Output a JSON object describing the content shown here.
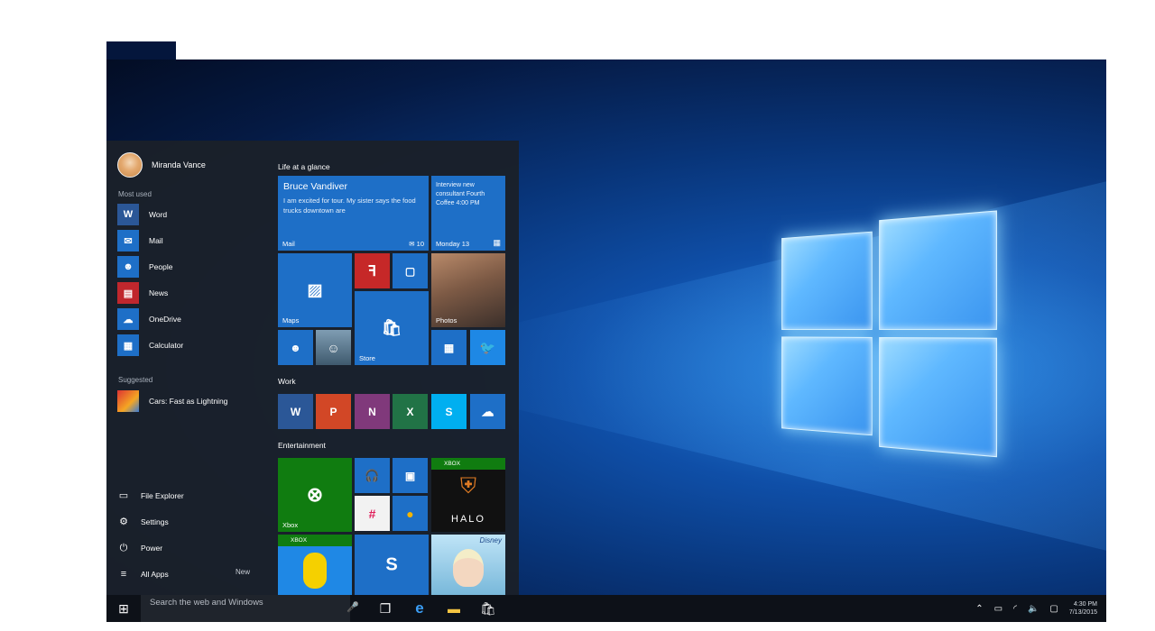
{
  "user": {
    "name": "Miranda Vance"
  },
  "sections": {
    "most_used": "Most used",
    "suggested": "Suggested"
  },
  "most_used": [
    {
      "label": "Word",
      "icon": "word-icon",
      "glyph": "W",
      "color": "#2b5797"
    },
    {
      "label": "Mail",
      "icon": "mail-icon",
      "glyph": "✉",
      "color": "#1e6fc7"
    },
    {
      "label": "People",
      "icon": "people-icon",
      "glyph": "👥",
      "color": "#1e6fc7"
    },
    {
      "label": "News",
      "icon": "news-icon",
      "glyph": "▤",
      "color": "#c0272d"
    },
    {
      "label": "OneDrive",
      "icon": "onedrive-icon",
      "glyph": "☁",
      "color": "#1e6fc7"
    },
    {
      "label": "Calculator",
      "icon": "calculator-icon",
      "glyph": "▦",
      "color": "#1e6fc7"
    }
  ],
  "suggested": [
    {
      "label": "Cars: Fast as Lightning",
      "icon": "cars-game-icon"
    }
  ],
  "system_items": [
    {
      "label": "File Explorer",
      "icon": "folder-icon",
      "glyph": "▭"
    },
    {
      "label": "Settings",
      "icon": "gear-icon",
      "glyph": "⚙"
    },
    {
      "label": "Power",
      "icon": "power-icon",
      "glyph": "⏻"
    },
    {
      "label": "All Apps",
      "icon": "all-apps-icon",
      "glyph": "≡"
    }
  ],
  "all_apps_badge": "New",
  "groups": {
    "life": "Life at a glance",
    "work": "Work",
    "entertainment": "Entertainment"
  },
  "tiles": {
    "mail": {
      "from": "Bruce Vandiver",
      "text": "I am excited for tour. My sister says the food trucks downtown are",
      "label": "Mail",
      "count": "10"
    },
    "calendar": {
      "text": "Interview new consultant Fourth Coffee 4:00 PM",
      "label": "Monday 13"
    },
    "maps": {
      "label": "Maps"
    },
    "photos": {
      "label": "Photos"
    },
    "store": {
      "label": "Store"
    },
    "xbox": {
      "label": "Xbox"
    },
    "xbox_badge": "XBOX",
    "halo": "HALO",
    "disney": "Disney"
  },
  "colors": {
    "tile_blue": "#1e6fc7",
    "flipboard_red": "#c62828",
    "word": "#2b5797",
    "powerpoint": "#d24726",
    "onenote": "#80397b",
    "excel": "#217346",
    "skype": "#00aff0",
    "xbox_green": "#107c10"
  },
  "taskbar": {
    "search_placeholder": "Search the web and Windows",
    "time": "4:30 PM",
    "date": "7/13/2015"
  }
}
